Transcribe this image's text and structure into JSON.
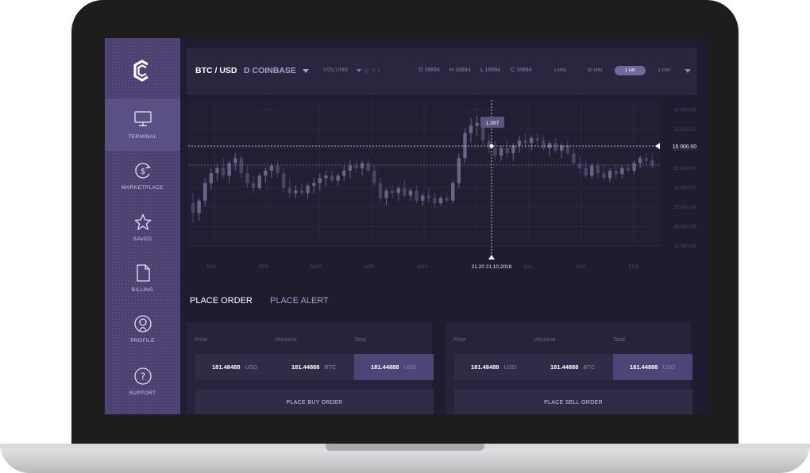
{
  "sidebar": {
    "items": [
      {
        "label": "TERMINAL",
        "icon": "monitor-icon",
        "active": true
      },
      {
        "label": "MARKETPLACE",
        "icon": "dollar-circle-icon",
        "active": false
      },
      {
        "label": "SAVED",
        "icon": "star-icon",
        "active": false
      },
      {
        "label": "BILLING",
        "icon": "document-icon",
        "active": false
      },
      {
        "label": "PROFILE",
        "icon": "user-circle-icon",
        "active": false
      },
      {
        "label": "SUPPORT",
        "icon": "question-circle-icon",
        "active": false
      }
    ]
  },
  "topbar": {
    "pair": "BTC / USD",
    "exchange": "D  COINBASE",
    "volume_label": "VOLUME",
    "volume_icons": "◎ ⊙ ×",
    "ohlc": {
      "o": "O 16894",
      "h": "H 16894",
      "l": "L 16894",
      "c": "C 16894"
    },
    "timeframes": [
      "1 MIN",
      "30 MIN",
      "1 HR",
      "1 DAY"
    ],
    "active_timeframe": "1 HR"
  },
  "chart_data": {
    "type": "candlestick",
    "x_tick_labels": [
      "JAN",
      "FEB",
      "MAR",
      "APR",
      "MAY",
      "21.20 21.10.2018",
      "JUL",
      "JAN",
      "FEB"
    ],
    "y_tick_labels": [
      "20 000.00",
      "15 000.00",
      "15 000.00",
      "15 000.00",
      "15 000.00",
      "15 000.00",
      "15 000.00",
      "15 000.00"
    ],
    "highlight_y_label": "15 000.00",
    "tooltip_value": "1,397",
    "crosshair_date": "21.20 21.10.2018",
    "candles": [
      {
        "o": 420,
        "h": 440,
        "l": 380,
        "c": 400
      },
      {
        "o": 400,
        "h": 430,
        "l": 385,
        "c": 425
      },
      {
        "o": 425,
        "h": 470,
        "l": 415,
        "c": 460
      },
      {
        "o": 460,
        "h": 490,
        "l": 445,
        "c": 480
      },
      {
        "o": 480,
        "h": 500,
        "l": 465,
        "c": 490
      },
      {
        "o": 490,
        "h": 510,
        "l": 470,
        "c": 475
      },
      {
        "o": 475,
        "h": 505,
        "l": 460,
        "c": 500
      },
      {
        "o": 500,
        "h": 520,
        "l": 485,
        "c": 510
      },
      {
        "o": 510,
        "h": 515,
        "l": 470,
        "c": 480
      },
      {
        "o": 480,
        "h": 495,
        "l": 450,
        "c": 460
      },
      {
        "o": 460,
        "h": 475,
        "l": 440,
        "c": 450
      },
      {
        "o": 450,
        "h": 480,
        "l": 445,
        "c": 475
      },
      {
        "o": 475,
        "h": 490,
        "l": 460,
        "c": 485
      },
      {
        "o": 485,
        "h": 500,
        "l": 470,
        "c": 495
      },
      {
        "o": 495,
        "h": 505,
        "l": 470,
        "c": 480
      },
      {
        "o": 480,
        "h": 490,
        "l": 440,
        "c": 450
      },
      {
        "o": 450,
        "h": 470,
        "l": 430,
        "c": 440
      },
      {
        "o": 440,
        "h": 455,
        "l": 430,
        "c": 445
      },
      {
        "o": 445,
        "h": 460,
        "l": 435,
        "c": 440
      },
      {
        "o": 440,
        "h": 460,
        "l": 430,
        "c": 455
      },
      {
        "o": 455,
        "h": 470,
        "l": 440,
        "c": 460
      },
      {
        "o": 460,
        "h": 480,
        "l": 445,
        "c": 470
      },
      {
        "o": 470,
        "h": 485,
        "l": 455,
        "c": 475
      },
      {
        "o": 475,
        "h": 485,
        "l": 460,
        "c": 465
      },
      {
        "o": 465,
        "h": 480,
        "l": 455,
        "c": 475
      },
      {
        "o": 475,
        "h": 495,
        "l": 465,
        "c": 485
      },
      {
        "o": 485,
        "h": 505,
        "l": 470,
        "c": 495
      },
      {
        "o": 495,
        "h": 505,
        "l": 480,
        "c": 490
      },
      {
        "o": 490,
        "h": 505,
        "l": 475,
        "c": 500
      },
      {
        "o": 500,
        "h": 510,
        "l": 480,
        "c": 485
      },
      {
        "o": 485,
        "h": 495,
        "l": 455,
        "c": 460
      },
      {
        "o": 460,
        "h": 470,
        "l": 420,
        "c": 430
      },
      {
        "o": 430,
        "h": 450,
        "l": 415,
        "c": 445
      },
      {
        "o": 445,
        "h": 455,
        "l": 430,
        "c": 440
      },
      {
        "o": 440,
        "h": 455,
        "l": 425,
        "c": 450
      },
      {
        "o": 450,
        "h": 465,
        "l": 430,
        "c": 435
      },
      {
        "o": 435,
        "h": 450,
        "l": 425,
        "c": 445
      },
      {
        "o": 445,
        "h": 455,
        "l": 420,
        "c": 425
      },
      {
        "o": 425,
        "h": 440,
        "l": 415,
        "c": 435
      },
      {
        "o": 435,
        "h": 450,
        "l": 420,
        "c": 430
      },
      {
        "o": 430,
        "h": 440,
        "l": 410,
        "c": 420
      },
      {
        "o": 420,
        "h": 435,
        "l": 415,
        "c": 430
      },
      {
        "o": 430,
        "h": 440,
        "l": 420,
        "c": 425
      },
      {
        "o": 425,
        "h": 465,
        "l": 420,
        "c": 460
      },
      {
        "o": 460,
        "h": 520,
        "l": 450,
        "c": 510
      },
      {
        "o": 510,
        "h": 570,
        "l": 500,
        "c": 560
      },
      {
        "o": 560,
        "h": 590,
        "l": 540,
        "c": 575
      },
      {
        "o": 575,
        "h": 595,
        "l": 555,
        "c": 580
      },
      {
        "o": 580,
        "h": 590,
        "l": 535,
        "c": 545
      },
      {
        "o": 545,
        "h": 560,
        "l": 520,
        "c": 530
      },
      {
        "o": 530,
        "h": 545,
        "l": 505,
        "c": 515
      },
      {
        "o": 515,
        "h": 535,
        "l": 505,
        "c": 530
      },
      {
        "o": 530,
        "h": 545,
        "l": 510,
        "c": 520
      },
      {
        "o": 520,
        "h": 540,
        "l": 505,
        "c": 535
      },
      {
        "o": 535,
        "h": 555,
        "l": 520,
        "c": 545
      },
      {
        "o": 545,
        "h": 560,
        "l": 530,
        "c": 540
      },
      {
        "o": 540,
        "h": 555,
        "l": 525,
        "c": 550
      },
      {
        "o": 550,
        "h": 560,
        "l": 535,
        "c": 545
      },
      {
        "o": 545,
        "h": 555,
        "l": 525,
        "c": 530
      },
      {
        "o": 530,
        "h": 545,
        "l": 515,
        "c": 540
      },
      {
        "o": 540,
        "h": 550,
        "l": 520,
        "c": 525
      },
      {
        "o": 525,
        "h": 540,
        "l": 510,
        "c": 535
      },
      {
        "o": 535,
        "h": 545,
        "l": 515,
        "c": 520
      },
      {
        "o": 520,
        "h": 530,
        "l": 495,
        "c": 500
      },
      {
        "o": 500,
        "h": 515,
        "l": 480,
        "c": 490
      },
      {
        "o": 490,
        "h": 505,
        "l": 470,
        "c": 475
      },
      {
        "o": 475,
        "h": 500,
        "l": 468,
        "c": 495
      },
      {
        "o": 495,
        "h": 505,
        "l": 470,
        "c": 480
      },
      {
        "o": 480,
        "h": 495,
        "l": 465,
        "c": 470
      },
      {
        "o": 470,
        "h": 490,
        "l": 462,
        "c": 485
      },
      {
        "o": 485,
        "h": 495,
        "l": 470,
        "c": 478
      },
      {
        "o": 478,
        "h": 495,
        "l": 470,
        "c": 490
      },
      {
        "o": 490,
        "h": 500,
        "l": 480,
        "c": 485
      },
      {
        "o": 485,
        "h": 505,
        "l": 478,
        "c": 500
      },
      {
        "o": 500,
        "h": 515,
        "l": 490,
        "c": 510
      },
      {
        "o": 510,
        "h": 520,
        "l": 495,
        "c": 505
      },
      {
        "o": 505,
        "h": 520,
        "l": 490,
        "c": 495
      }
    ]
  },
  "order": {
    "tabs": [
      "PLACE ORDER",
      "PLACE ALERT"
    ],
    "active_tab": "PLACE ORDER",
    "buy": {
      "labels": [
        "Price",
        "Vlounme",
        "Total"
      ],
      "fields": [
        {
          "value": "181.48488",
          "unit": "USD"
        },
        {
          "value": "181.44888",
          "unit": "BTC"
        },
        {
          "value": "181.44888",
          "unit": "USD"
        }
      ],
      "button": "PLACE BUY ORDER"
    },
    "sell": {
      "labels": [
        "Price",
        "Vlounme",
        "Total"
      ],
      "fields": [
        {
          "value": "181.48488",
          "unit": "USD"
        },
        {
          "value": "181.44888",
          "unit": "BTC"
        },
        {
          "value": "181.44888",
          "unit": "USD"
        }
      ],
      "button": "PLACE SELL ORDER"
    }
  },
  "colors": {
    "accent": "#6f6a99",
    "sidebar": "#4b4070",
    "background": "#1f1c30"
  }
}
